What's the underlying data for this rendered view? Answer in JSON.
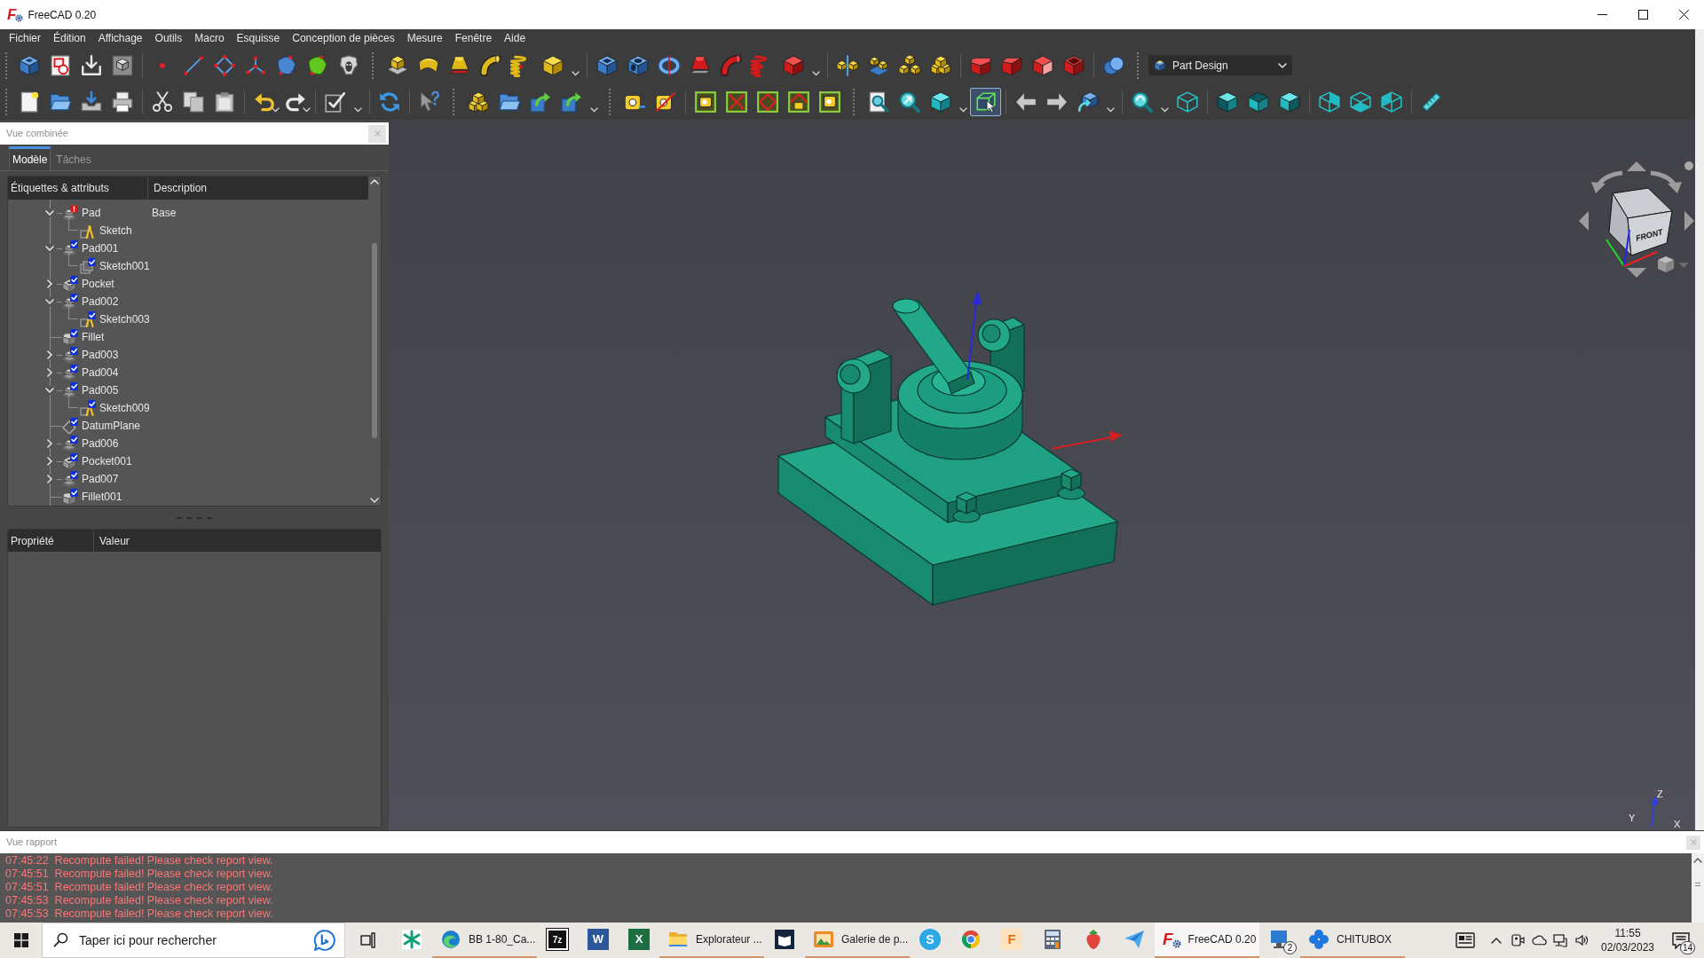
{
  "window": {
    "logo_text": "F",
    "title": "FreeCAD 0.20"
  },
  "menu": [
    "Fichier",
    "Édition",
    "Affichage",
    "Outils",
    "Macro",
    "Esquisse",
    "Conception de pièces",
    "Mesure",
    "Fenêtre",
    "Aide"
  ],
  "toolbar": {
    "workbench": "Part Design",
    "box_selection": {
      "on": true
    }
  },
  "combo_view": {
    "title": "Vue combinée",
    "tabs": [
      {
        "label": "Modèle",
        "selected": true
      },
      {
        "label": "Tâches",
        "selected": false
      }
    ],
    "tree": {
      "columns": [
        "Étiquettes & attributs",
        "Description"
      ],
      "items": [
        {
          "label": "Pad",
          "kind": "pad",
          "valid": false,
          "error": true,
          "description": "Base",
          "expanded": true,
          "children": [
            {
              "label": "Sketch",
              "kind": "sketch",
              "valid": false,
              "error": false
            }
          ]
        },
        {
          "label": "Pad001",
          "kind": "pad",
          "valid": true,
          "error": false,
          "expanded": true,
          "children": [
            {
              "label": "Sketch001",
              "kind": "sheet",
              "valid": true,
              "error": false
            }
          ]
        },
        {
          "label": "Pocket",
          "kind": "pocket",
          "valid": true,
          "error": false,
          "expanded": false
        },
        {
          "label": "Pad002",
          "kind": "pad",
          "valid": true,
          "error": false,
          "expanded": true,
          "children": [
            {
              "label": "Sketch003",
              "kind": "sketch",
              "valid": true,
              "error": false
            }
          ]
        },
        {
          "label": "Fillet",
          "kind": "fillet",
          "valid": true,
          "error": false
        },
        {
          "label": "Pad003",
          "kind": "pad",
          "valid": true,
          "error": false,
          "expanded": false
        },
        {
          "label": "Pad004",
          "kind": "pad",
          "valid": true,
          "error": false,
          "expanded": false
        },
        {
          "label": "Pad005",
          "kind": "pad",
          "valid": true,
          "error": false,
          "expanded": true,
          "children": [
            {
              "label": "Sketch009",
              "kind": "sketch",
              "valid": true,
              "error": false
            }
          ]
        },
        {
          "label": "DatumPlane",
          "kind": "plane",
          "valid": true,
          "error": false
        },
        {
          "label": "Pad006",
          "kind": "pad",
          "valid": true,
          "error": false,
          "expanded": false
        },
        {
          "label": "Pocket001",
          "kind": "pocket",
          "valid": true,
          "error": false,
          "expanded": false
        },
        {
          "label": "Pad007",
          "kind": "pad",
          "valid": true,
          "error": false,
          "expanded": false
        },
        {
          "label": "Fillet001",
          "kind": "fillet",
          "valid": true,
          "error": false
        }
      ]
    },
    "properties": {
      "columns": [
        "Propriété",
        "Valeur"
      ]
    }
  },
  "viewport": {
    "nav_cube": {
      "face_label": "FRONT"
    },
    "axis_labels": [
      "Z",
      "Y",
      "X"
    ]
  },
  "report_view": {
    "title": "Vue rapport",
    "lines": [
      "07:45:22  Recompute failed! Please check report view.",
      "07:45:51  Recompute failed! Please check report view.",
      "07:45:51  Recompute failed! Please check report view.",
      "07:45:53  Recompute failed! Please check report view.",
      "07:45:53  Recompute failed! Please check report view."
    ]
  },
  "taskbar": {
    "search": {
      "placeholder": "Taper ici pour rechercher"
    },
    "apps": [
      {
        "running": false,
        "selected": false
      },
      {
        "label": "BB 1-80_Ca...",
        "running": true,
        "selected": false
      },
      {
        "icon_text": "7z",
        "running": false,
        "selected": false
      },
      {
        "icon_text": "W",
        "running": false,
        "selected": false
      },
      {
        "icon_text": "X",
        "running": false,
        "selected": false
      },
      {
        "label": "Explorateur ...",
        "running": true,
        "selected": false
      },
      {
        "running": false,
        "selected": false
      },
      {
        "label": "Galerie de p...",
        "running": true,
        "selected": false
      },
      {
        "icon_text": "S",
        "running": false,
        "selected": false
      },
      {
        "running": false,
        "selected": false
      },
      {
        "icon_text": "F",
        "running": false,
        "selected": false
      },
      {
        "running": false,
        "selected": false
      },
      {
        "running": false,
        "selected": false
      },
      {
        "running": false,
        "selected": false
      },
      {
        "icon_text": "F",
        "label": "FreeCAD 0.20",
        "running": true,
        "selected": true
      },
      {
        "badge": "2",
        "running": false,
        "selected": false
      },
      {
        "label": "CHITUBOX",
        "running": true,
        "selected": false
      }
    ],
    "clock": {
      "time": "11:55",
      "date": "02/03/2023"
    },
    "notifications": {
      "count": "14"
    }
  }
}
